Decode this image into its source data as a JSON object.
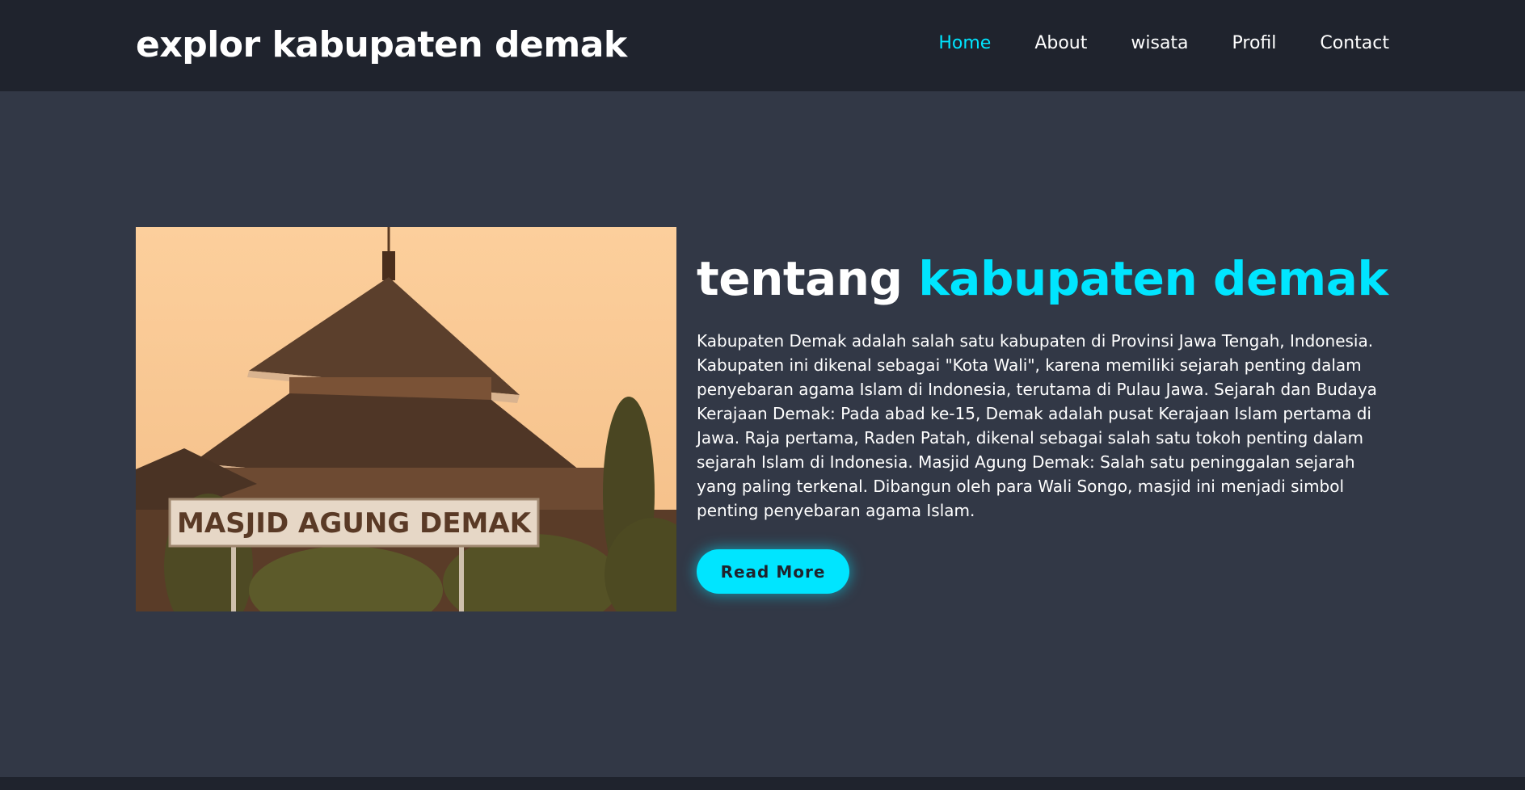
{
  "header": {
    "logo": "explor kabupaten demak",
    "nav": [
      {
        "label": "Home",
        "active": true
      },
      {
        "label": "About",
        "active": false
      },
      {
        "label": "wisata",
        "active": false
      },
      {
        "label": "Profil",
        "active": false
      },
      {
        "label": "Contact",
        "active": false
      }
    ]
  },
  "about": {
    "title_plain": "tentang",
    "title_accent": "kabupaten demak",
    "body": "Kabupaten Demak adalah salah satu kabupaten di Provinsi Jawa Tengah, Indonesia. Kabupaten ini dikenal sebagai \"Kota Wali\", karena memiliki sejarah penting dalam penyebaran agama Islam di Indonesia, terutama di Pulau Jawa. Sejarah dan Budaya Kerajaan Demak: Pada abad ke-15, Demak adalah pusat Kerajaan Islam pertama di Jawa. Raja pertama, Raden Patah, dikenal sebagai salah satu tokoh penting dalam sejarah Islam di Indonesia. Masjid Agung Demak: Salah satu peninggalan sejarah yang paling terkenal. Dibangun oleh para Wali Songo, masjid ini menjadi simbol penting penyebaran agama Islam.",
    "image_sign": "MASJID AGUNG DEMAK",
    "button_label": "Read More"
  },
  "colors": {
    "accent": "#00e5ff",
    "header_bg": "#1f232d",
    "page_bg": "#323846"
  }
}
